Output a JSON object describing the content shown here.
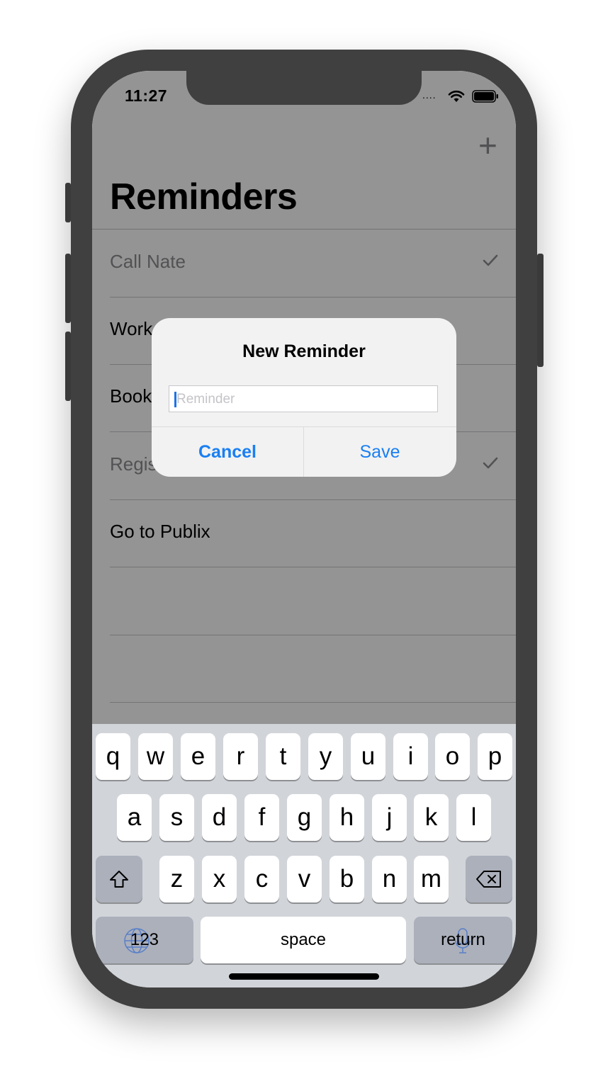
{
  "status_bar": {
    "time": "11:27",
    "signal": "....",
    "wifi_icon": "wifi-icon",
    "battery_icon": "battery-icon"
  },
  "nav": {
    "add_icon": "plus-icon",
    "add_label": "+",
    "title": "Reminders"
  },
  "reminders": [
    {
      "text": "Call Nate",
      "completed": true
    },
    {
      "text": "Work",
      "completed": false
    },
    {
      "text": "Book",
      "completed": false
    },
    {
      "text": "Regis",
      "completed": true
    },
    {
      "text": "Go to Publix",
      "completed": false
    },
    {
      "text": "",
      "completed": false
    },
    {
      "text": "",
      "completed": false
    }
  ],
  "alert": {
    "title": "New Reminder",
    "field": {
      "value": "",
      "placeholder": "Reminder"
    },
    "cancel_label": "Cancel",
    "save_label": "Save"
  },
  "keyboard": {
    "row1": [
      "q",
      "w",
      "e",
      "r",
      "t",
      "y",
      "u",
      "i",
      "o",
      "p"
    ],
    "row2": [
      "a",
      "s",
      "d",
      "f",
      "g",
      "h",
      "j",
      "k",
      "l"
    ],
    "row3": [
      "z",
      "x",
      "c",
      "v",
      "b",
      "n",
      "m"
    ],
    "shift_icon": "shift-icon",
    "delete_icon": "delete-icon",
    "numbers_label": "123",
    "globe_icon": "globe-icon",
    "space_label": "space",
    "return_label": "return",
    "mic_icon": "microphone-icon"
  },
  "colors": {
    "accent": "#1a7ff2",
    "caret": "#1a73e8",
    "keyboard_bg": "#d1d4d9",
    "frame": "#404040"
  }
}
